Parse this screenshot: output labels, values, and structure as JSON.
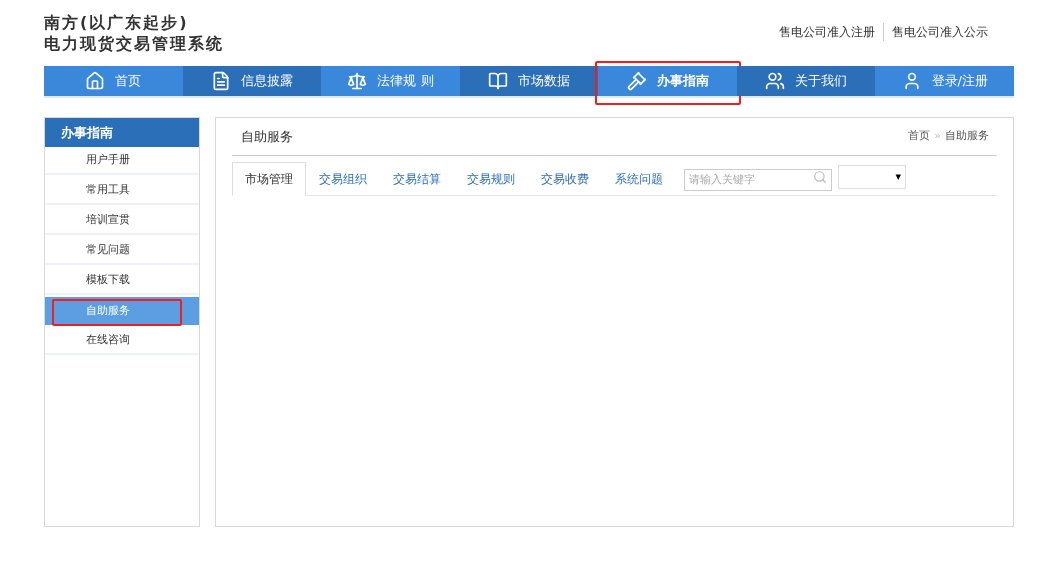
{
  "header": {
    "title_lines": [
      "南方(以广东起步)",
      "电力现货交易管理系统"
    ],
    "top_links": [
      "售电公司准入注册",
      "售电公司准入公示"
    ]
  },
  "nav": [
    {
      "label": "首页",
      "kind": "home",
      "selected": false,
      "highlighted": false
    },
    {
      "label": "信息披露",
      "kind": "notice",
      "selected": false,
      "highlighted": false
    },
    {
      "label": "法律规 则",
      "kind": "scale",
      "selected": false,
      "highlighted": false
    },
    {
      "label": "市场数据",
      "kind": "book",
      "selected": false,
      "highlighted": false
    },
    {
      "label": "办事指南",
      "kind": "gavel",
      "selected": true,
      "highlighted": true
    },
    {
      "label": "关于我们",
      "kind": "users",
      "selected": false,
      "highlighted": false
    },
    {
      "label": "登录/注册",
      "kind": "user",
      "selected": false,
      "highlighted": false
    }
  ],
  "sidebar": {
    "title": "办事指南",
    "items": [
      {
        "label": "用户手册",
        "selected": false,
        "highlighted": false
      },
      {
        "label": "常用工具",
        "selected": false,
        "highlighted": false
      },
      {
        "label": "培训宣贯",
        "selected": false,
        "highlighted": false
      },
      {
        "label": "常见问题",
        "selected": false,
        "highlighted": false
      },
      {
        "label": "模板下载",
        "selected": false,
        "highlighted": false
      },
      {
        "label": "自助服务",
        "selected": true,
        "highlighted": true
      },
      {
        "label": "在线咨询",
        "selected": false,
        "highlighted": false
      }
    ]
  },
  "main": {
    "title": "自助服务",
    "breadcrumb": [
      "首页",
      "»",
      "自助服务"
    ],
    "tabs": [
      {
        "label": "市场管理",
        "selected": true
      },
      {
        "label": "交易组织",
        "selected": false
      },
      {
        "label": "交易结算",
        "selected": false
      },
      {
        "label": "交易规则",
        "selected": false
      },
      {
        "label": "交易收费",
        "selected": false
      },
      {
        "label": "系统问题",
        "selected": false
      }
    ],
    "search": {
      "placeholder": "请输入关键字"
    },
    "dropdown_arrow": "▾"
  }
}
